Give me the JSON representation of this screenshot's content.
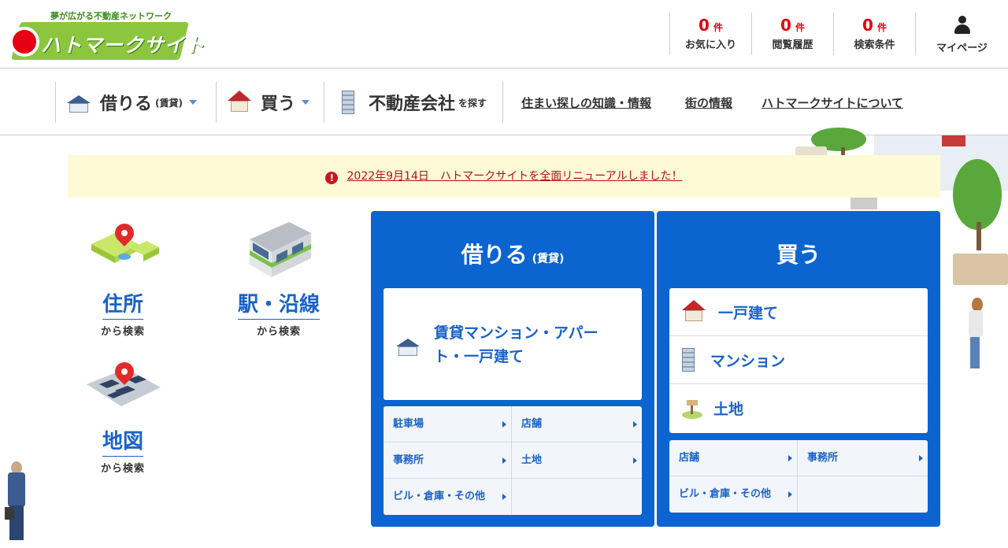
{
  "header": {
    "tagline": "夢が広がる不動産ネットワーク",
    "logo_text": "ハトマークサイト",
    "counters": [
      {
        "count": "0",
        "unit": "件",
        "label": "お気に入り"
      },
      {
        "count": "0",
        "unit": "件",
        "label": "閲覧履歴"
      },
      {
        "count": "0",
        "unit": "件",
        "label": "検索条件"
      }
    ],
    "mypage_label": "マイページ"
  },
  "nav": {
    "rent": {
      "label": "借りる",
      "sub": "(賃貸)"
    },
    "buy": {
      "label": "買う"
    },
    "agency": {
      "label": "不動産会社",
      "sub": "を探す"
    },
    "links": [
      "住まい探しの知識・情報",
      "街の情報",
      "ハトマークサイトについて"
    ]
  },
  "notice": {
    "text": "2022年9月14日　ハトマークサイトを全面リニューアルしました！"
  },
  "search": {
    "address": {
      "label": "住所",
      "sub": "から検索"
    },
    "station": {
      "label": "駅・沿線",
      "sub": "から検索"
    },
    "map": {
      "label": "地図",
      "sub": "から検索"
    }
  },
  "rent_panel": {
    "title": "借りる",
    "title_sub": "(賃貸)",
    "main_card": "賃貸マンション・アパート・一戸建て",
    "sub_items": [
      "駐車場",
      "店舗",
      "事務所",
      "土地",
      "ビル・倉庫・その他"
    ]
  },
  "buy_panel": {
    "title": "買う",
    "items": [
      "一戸建て",
      "マンション",
      "土地"
    ],
    "sub_items": [
      "店舗",
      "事務所",
      "ビル・倉庫・その他"
    ]
  },
  "colors": {
    "brand_blue": "#0b64d0",
    "accent_red": "#e60012",
    "brand_green": "#8cc63f",
    "notice_bg": "#fdfad6"
  }
}
